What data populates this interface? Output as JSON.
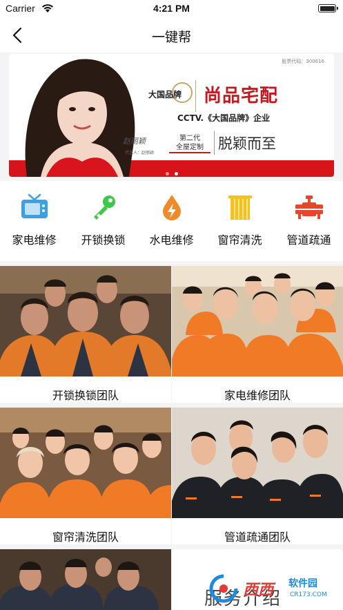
{
  "status_bar": {
    "carrier": "Carrier",
    "time": "4:21 PM"
  },
  "nav": {
    "title": "一键帮"
  },
  "banner": {
    "stock_code": "股票代码：300616",
    "brand_logo": "大国品牌",
    "headline": "尚品宅配",
    "cctv_line": "CCTV.《大国品牌》企业",
    "sub_line_1": "第二代",
    "sub_line_2": "全屋定制",
    "slogan": "脱颖而至",
    "signature_caption": "代言人：赵丽颖",
    "active_dot": 2,
    "dot_count": 2
  },
  "services": [
    {
      "label": "家电维修",
      "icon": "tv-icon",
      "color": "#3aa0e8"
    },
    {
      "label": "开锁换锁",
      "icon": "key-icon",
      "color": "#3ec84a"
    },
    {
      "label": "水电维修",
      "icon": "water-electric-icon",
      "color": "#f08a2a"
    },
    {
      "label": "窗帘清洗",
      "icon": "curtain-icon",
      "color": "#f5c21b"
    },
    {
      "label": "管道疏通",
      "icon": "pipe-icon",
      "color": "#e8452f"
    }
  ],
  "teams": [
    {
      "label": "开锁换锁团队"
    },
    {
      "label": "家电维修团队"
    },
    {
      "label": "窗帘清洗团队"
    },
    {
      "label": "管道疏通团队"
    }
  ],
  "partial_card_text": "服务介绍",
  "watermark": {
    "brand": "西西",
    "site_name": "软件园",
    "url": "CR173.COM"
  }
}
